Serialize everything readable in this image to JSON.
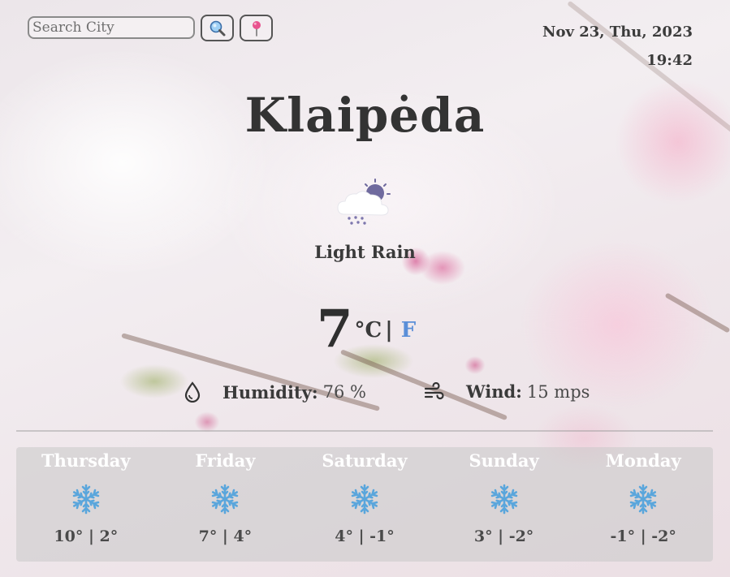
{
  "search": {
    "placeholder": "Search City"
  },
  "datetime": {
    "date": "Nov 23, Thu, 2023",
    "time": "19:42"
  },
  "current": {
    "city": "Klaipėda",
    "condition": "Light Rain",
    "condition_icon": "cloud-rain-moon-icon",
    "temperature": "7",
    "unit_c": "°C",
    "unit_separator": "|",
    "unit_f": "F",
    "humidity_label": "Humidity:",
    "humidity_value": "76 %",
    "wind_label": "Wind:",
    "wind_value": "15 mps"
  },
  "forecast": [
    {
      "day": "Thursday",
      "icon": "snowflake-icon",
      "temps": "10° | 2°"
    },
    {
      "day": "Friday",
      "icon": "snowflake-icon",
      "temps": "7° | 4°"
    },
    {
      "day": "Saturday",
      "icon": "snowflake-icon",
      "temps": "4° | -1°"
    },
    {
      "day": "Sunday",
      "icon": "snowflake-icon",
      "temps": "3° | -2°"
    },
    {
      "day": "Monday",
      "icon": "snowflake-icon",
      "temps": "-1° | -2°"
    }
  ],
  "colors": {
    "accent_unit": "#5b8fd8",
    "snowflake": "#5aa6dc",
    "forecast_panel": "#c8c8c8"
  }
}
